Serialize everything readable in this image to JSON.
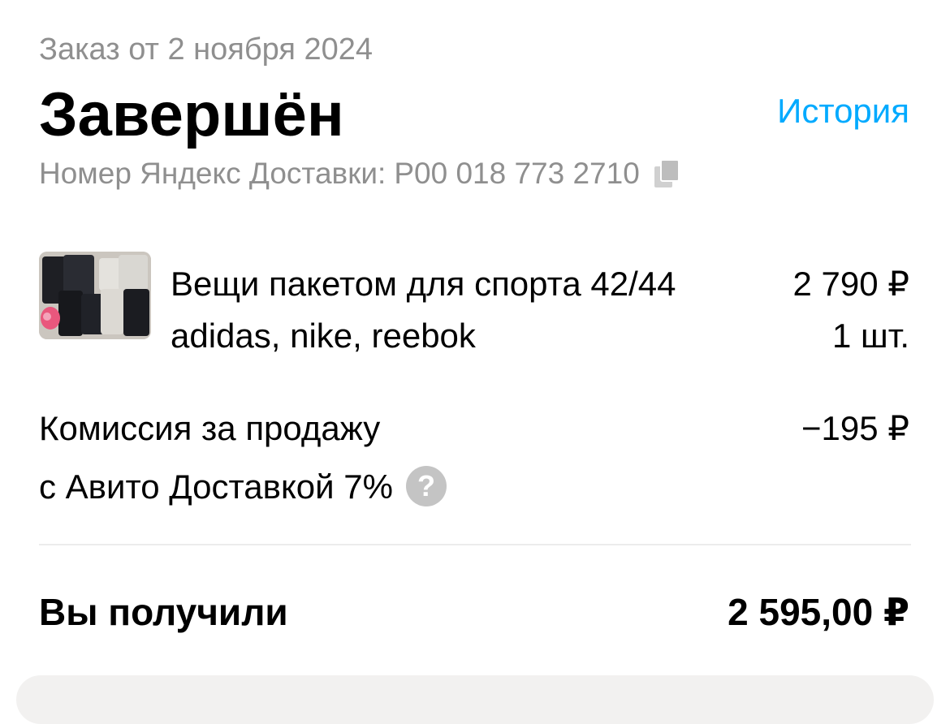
{
  "order": {
    "date_text": "Заказ от 2 ноября 2024",
    "status": "Завершён",
    "history_link": "История",
    "tracking_label": "Номер Яндекс Доставки:",
    "tracking_number": "P00 018 773 2710"
  },
  "item": {
    "title": "Вещи пакетом для спорта 42/44 adidas, nike, reebok",
    "price": "2 790 ₽",
    "quantity": "1 шт."
  },
  "fee": {
    "label_line1": "Комиссия за продажу",
    "label_line2": "с Авито Доставкой 7%",
    "amount": "−195 ₽",
    "help_glyph": "?"
  },
  "total": {
    "label": "Вы получили",
    "amount": "2 595,00 ₽"
  },
  "icons": {
    "copy": "copy-icon",
    "help": "help-icon"
  },
  "colors": {
    "link": "#00aaff",
    "secondary_text": "#8f8f8f",
    "divider": "#ececec",
    "help_icon_bg": "#c4c4c4"
  }
}
